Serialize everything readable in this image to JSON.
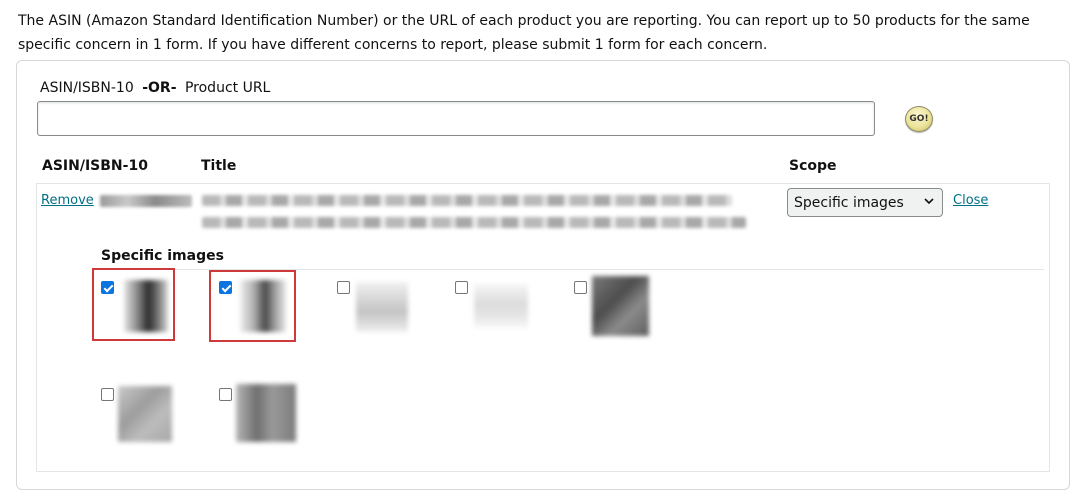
{
  "intro_text": "The ASIN (Amazon Standard Identification Number) or the URL of each product you are reporting. You can report up to 50 products for the same specific concern in 1 form. If you have different concerns to report, please submit 1 form for each concern.",
  "lookup": {
    "label_left": "ASIN/ISBN-10",
    "label_or": "-OR-",
    "label_right": "Product URL",
    "input_value": "",
    "go_label": "GO!"
  },
  "table": {
    "headers": {
      "asin": "ASIN/ISBN-10",
      "title": "Title",
      "scope": "Scope"
    },
    "row": {
      "remove_label": "Remove",
      "scope_value": "Specific images",
      "close_label": "Close"
    }
  },
  "specific_images": {
    "heading": "Specific images",
    "images": [
      {
        "checked": true,
        "highlighted": true
      },
      {
        "checked": true,
        "highlighted": true
      },
      {
        "checked": false,
        "highlighted": false
      },
      {
        "checked": false,
        "highlighted": false
      },
      {
        "checked": false,
        "highlighted": false
      },
      {
        "checked": false,
        "highlighted": false
      },
      {
        "checked": false,
        "highlighted": false
      }
    ]
  },
  "colors": {
    "link": "#007185",
    "checkbox_checked": "#0b74de",
    "highlight_border": "#d0393a"
  }
}
